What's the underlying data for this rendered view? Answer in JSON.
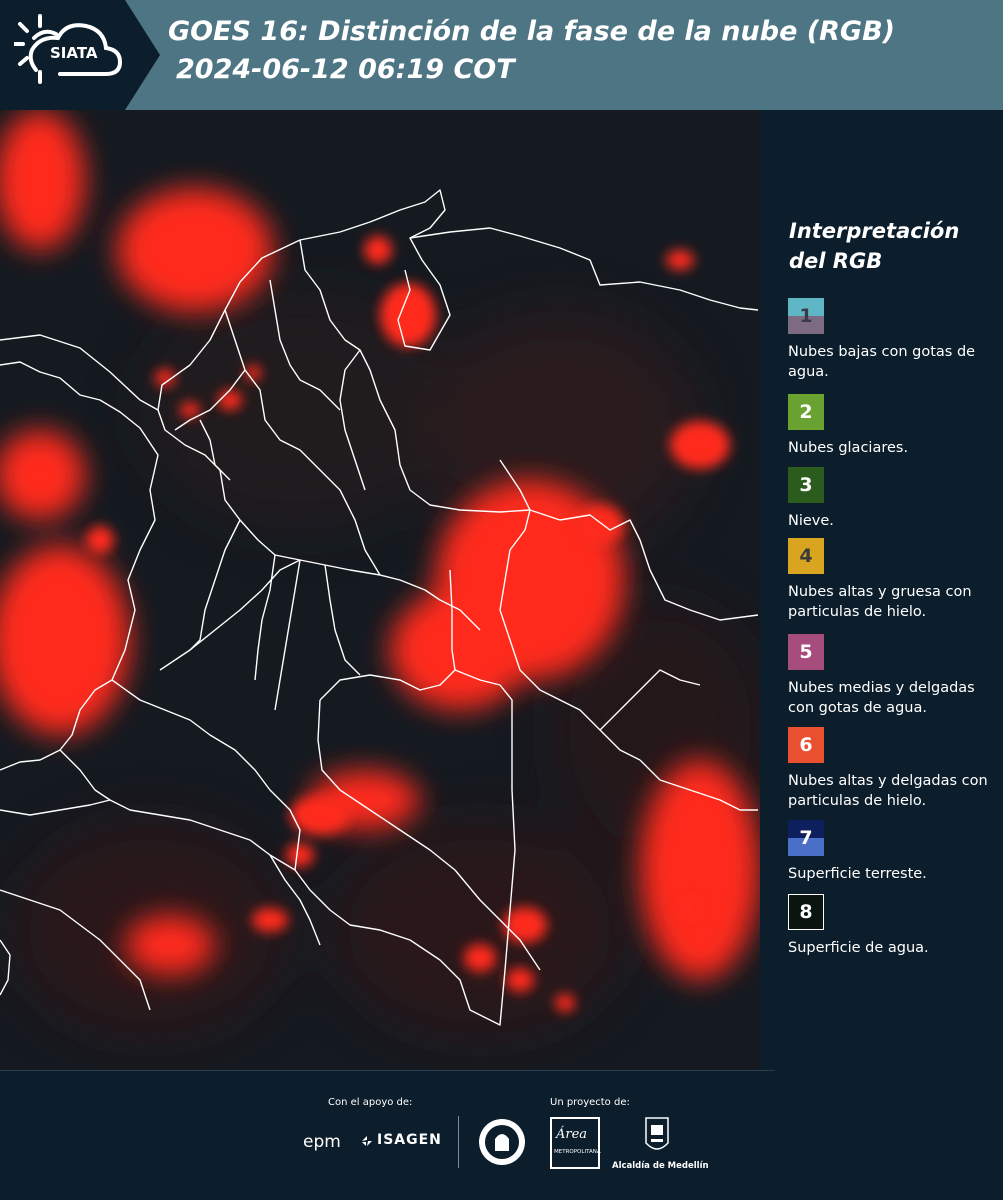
{
  "header": {
    "logo_text": "SIATA",
    "title": "GOES 16: Distinción de la fase de la nube (RGB)",
    "subtitle": "2024-06-12 06:19 COT"
  },
  "legend": {
    "title": "Interpretación del RGB",
    "items": [
      {
        "number": "1",
        "label": "Nubes bajas con gotas de agua.",
        "color_top": "#5fb6c4",
        "color_bottom": "#7c6b82",
        "text_color": "#3a3a4a"
      },
      {
        "number": "2",
        "label": "Nubes glaciares.",
        "color_top": "#6aa232",
        "color_bottom": "#6aa232",
        "text_color": "#ffffff"
      },
      {
        "number": "3",
        "label": "Nieve.",
        "color_top": "#2c5c1d",
        "color_bottom": "#2c5c1d",
        "text_color": "#ffffff"
      },
      {
        "number": "4",
        "label": "Nubes altas y gruesa con particulas de hielo.",
        "color_top": "#d9a420",
        "color_bottom": "#d9a420",
        "text_color": "#3a3a3a"
      },
      {
        "number": "5",
        "label": "Nubes medias y delgadas con gotas de agua.",
        "color_top": "#a64d7e",
        "color_bottom": "#a64d7e",
        "text_color": "#ffffff"
      },
      {
        "number": "6",
        "label": "Nubes altas y delgadas con particulas de hielo.",
        "color_top": "#e85030",
        "color_bottom": "#e85030",
        "text_color": "#ffffff"
      },
      {
        "number": "7",
        "label": "Superficie terreste.",
        "color_top": "#0d1f5c",
        "color_bottom": "#4a6fc8",
        "text_color": "#ffffff"
      },
      {
        "number": "8",
        "label": "Superficie de agua.",
        "color_top": "#0b1510",
        "color_bottom": "#0b1510",
        "text_color": "#ffffff"
      }
    ]
  },
  "footer": {
    "support_label": "Con el apoyo de:",
    "project_label": "Un proyecto de:",
    "epm": "epm",
    "isagen": "ISAGEN",
    "area_text": "Área",
    "area_sub": "METROPOLITANA",
    "alcaldia": "Alcaldía de Medellín"
  },
  "colors": {
    "header_bg": "#4e7584",
    "panel_bg": "#0c1d2b",
    "cloud_red": "#ff2a1f"
  }
}
